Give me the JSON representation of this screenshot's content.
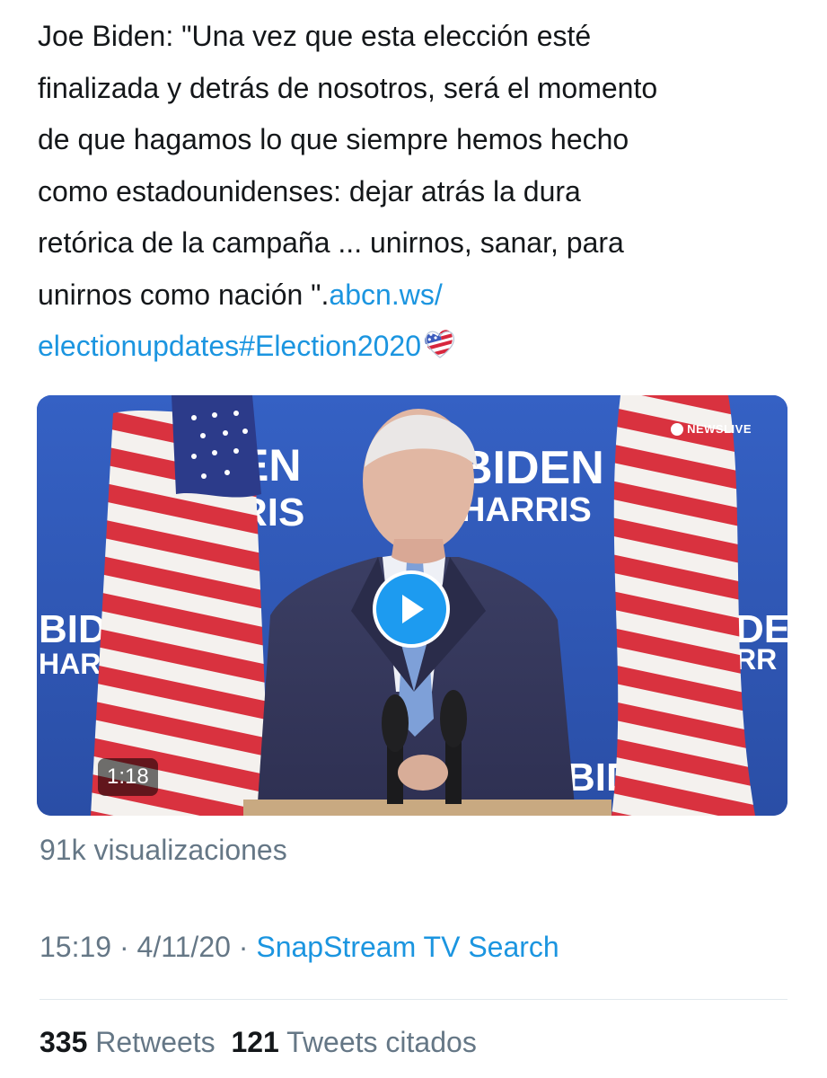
{
  "tweet": {
    "text_lines": [
      "Joe Biden: \"Una vez que esta elección esté",
      "finalizada y detrás de nosotros, será el momento",
      "de que hagamos lo que siempre hemos hecho",
      "como estadounidenses: dejar atrás la dura",
      "retórica de la campaña ... unirnos, sanar, para"
    ],
    "text_tail": "unirnos como nación \".",
    "link_part1": "abcn.ws/",
    "link_part2": "electionupdates",
    "hashtag": "#Election2020",
    "emoji_icon": "ballot-heart-icon"
  },
  "video": {
    "overlay_texts": {
      "left_top": "EN",
      "left_mid": "RIS",
      "center_top": "BIDEN",
      "center_mid": "HARRIS",
      "left_lower_top": "BIDE",
      "left_lower_mid": "HARR",
      "right_lower_top": "DE",
      "right_lower_mid": "RR",
      "bottom_right": "BID"
    },
    "network_bug": "NEWSLIVE",
    "duration": "1:18",
    "play_icon": "play-icon"
  },
  "views": "91k visualizaciones",
  "meta": {
    "time": "15:19",
    "sep1": " · ",
    "date": "4/11/20",
    "sep2": " · ",
    "source": "SnapStream TV Search"
  },
  "stats": {
    "retweets_count": "335",
    "retweets_label": "Retweets",
    "quotes_count": "121",
    "quotes_label": "Tweets citados"
  },
  "colors": {
    "text": "#14171a",
    "secondary": "#657786",
    "link": "#1b95e0",
    "divider": "#e1e8ed",
    "backdrop_blue": "#2f56b6"
  }
}
